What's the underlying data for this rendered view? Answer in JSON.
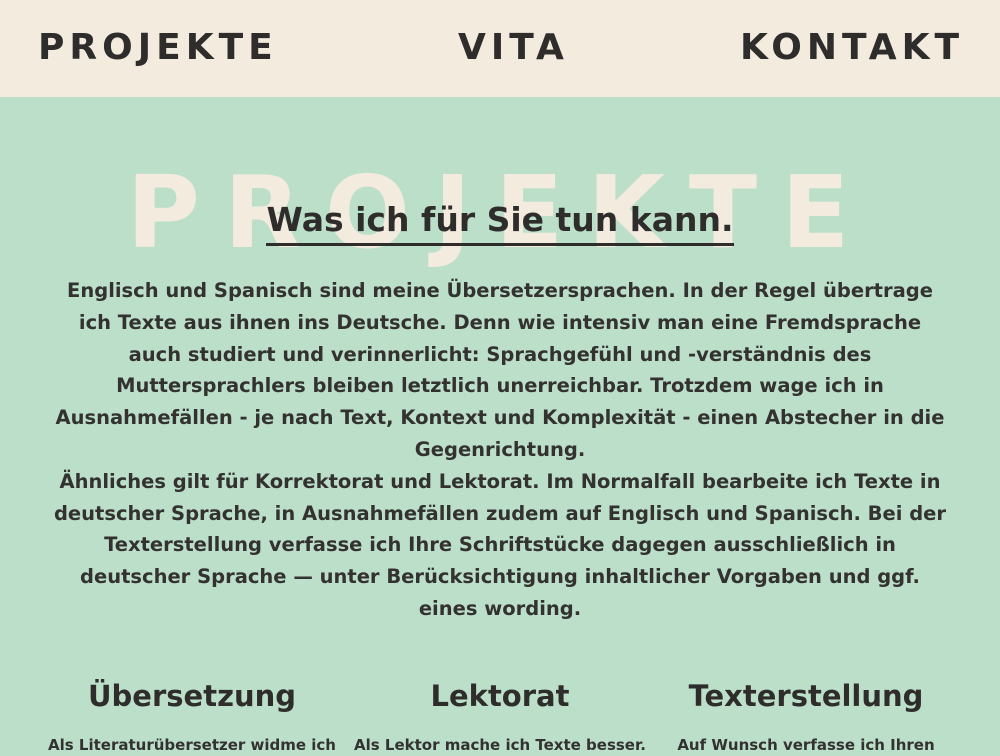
{
  "nav": {
    "projekte": "PROJEKTE",
    "vita": "VITA",
    "kontakt": "KONTAKT"
  },
  "hero": {
    "watermark": "PROJEKTE",
    "headline": "Was ich für Sie tun kann."
  },
  "intro": {
    "paragraph_1": "Englisch und Spanisch sind meine Übersetzersprachen. In der Regel übertrage ich Texte aus ihnen ins Deutsche. Denn wie intensiv man eine Fremdsprache auch studiert und verinnerlicht: Sprachgefühl und -verständnis des Muttersprachlers bleiben letztlich unerreichbar. Trotzdem wage ich in Ausnahmefällen - je nach Text, Kontext und Komplexität - einen Abstecher in die Gegenrichtung.",
    "paragraph_2": "Ähnliches gilt für Korrektorat und Lektorat. Im Normalfall bearbeite ich Texte in deutscher Sprache, in Ausnahmefällen zudem auf Englisch und Spanisch. Bei der Texterstellung verfasse ich Ihre Schriftstücke dagegen ausschließlich in deutscher Sprache — unter Berücksichtigung inhaltlicher Vorgaben und ggf. eines wording."
  },
  "services": [
    {
      "title": "Übersetzung",
      "text": "Als Literaturübersetzer widme ich"
    },
    {
      "title": "Lektorat",
      "text": "Als Lektor mache ich Texte besser."
    },
    {
      "title": "Texterstellung",
      "text": "Auf Wunsch verfasse ich Ihren"
    }
  ],
  "colors": {
    "background": "#bcdfca",
    "nav_background": "#f3ebde",
    "text": "#2f2d2b",
    "watermark": "#f3ebde"
  }
}
